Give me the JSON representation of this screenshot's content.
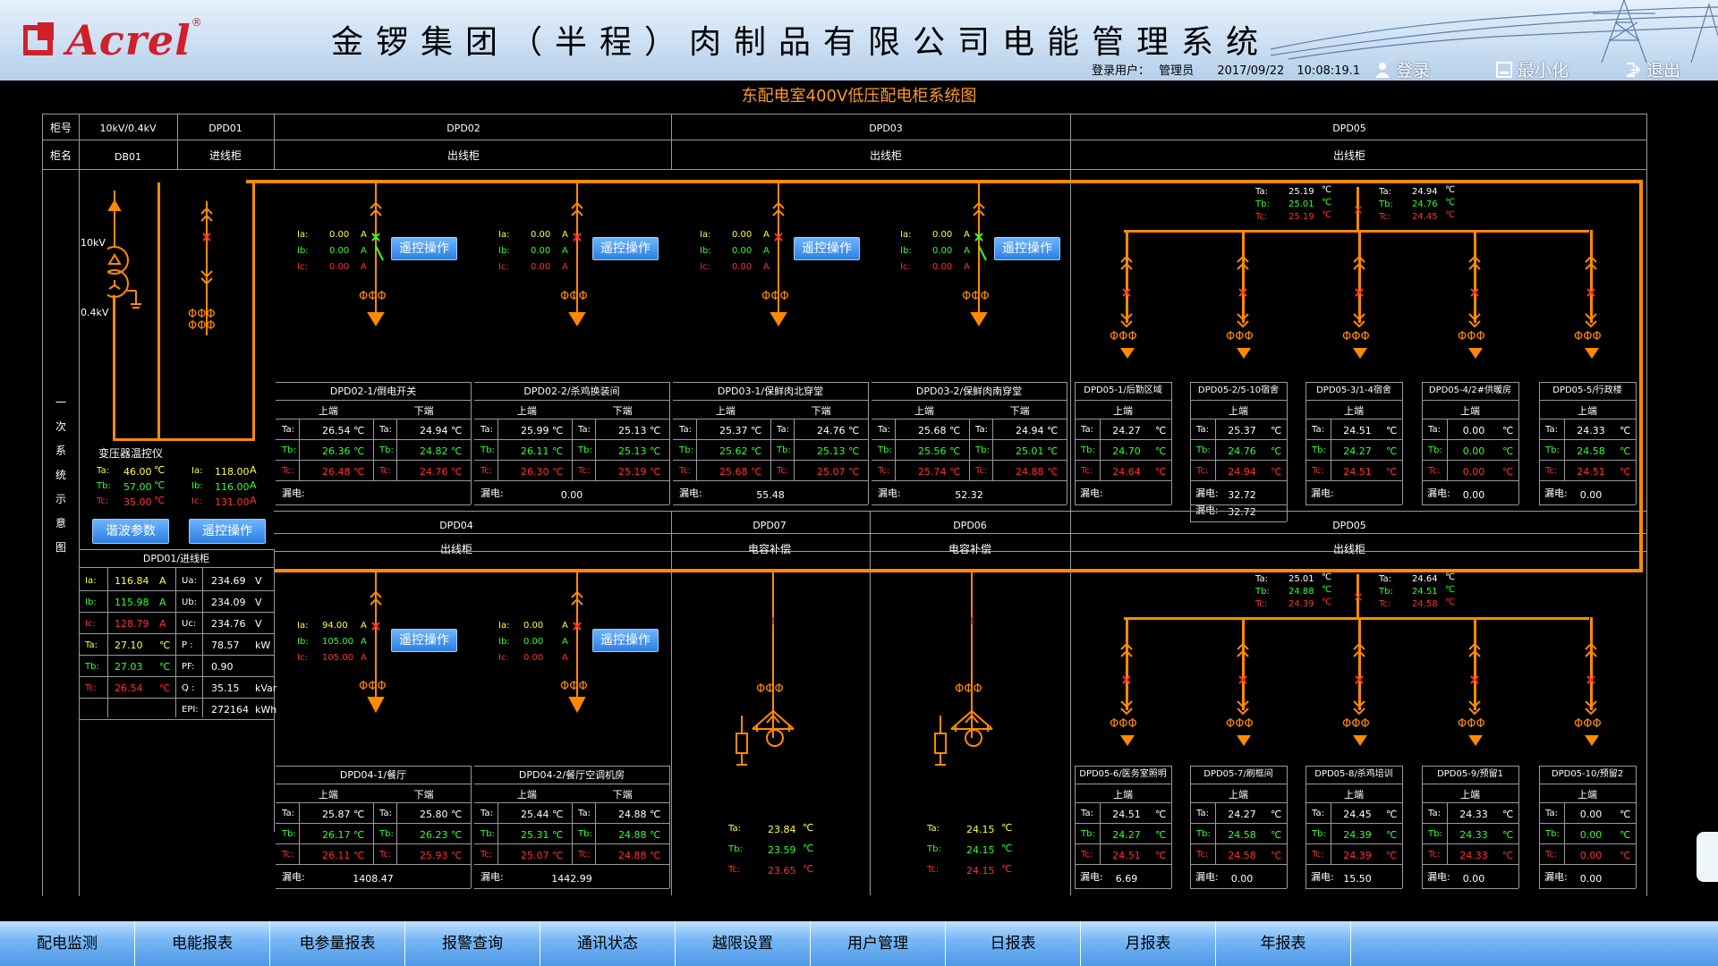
{
  "header": {
    "brand": "Acrel",
    "registered": "®",
    "title": "金锣集团（半程）肉制品有限公司电能管理系统",
    "user_label": "登录用户：",
    "user": "管理员",
    "date": "2017/09/22",
    "time": "10:08:19.1",
    "login": "登录",
    "minimize": "最小化",
    "logout": "退出"
  },
  "page_title": "东配电室400V低压配电柜系统图",
  "table": {
    "row1_label": "柜号",
    "row2_label": "柜名",
    "c1_no": "10kV/0.4kV",
    "c1_name": "DB01",
    "c2_no": "DPD01",
    "c2_name": "进线柜",
    "c3_no": "DPD02",
    "c3_name": "出线柜",
    "c4_no": "DPD03",
    "c4_name": "出线柜",
    "c5_no": "DPD05",
    "c5_name": "出线柜"
  },
  "side_label": [
    "一",
    "次",
    "系",
    "统",
    "示",
    "意",
    "图"
  ],
  "transformer": {
    "hv": "10kV",
    "lv": "0.4kV",
    "temp_title": "变压器温控仪",
    "Ta": "46.00",
    "Tb": "57.00",
    "Tc": "35.00",
    "unit": "℃",
    "harmonic_btn": "谐波参数"
  },
  "incomer": {
    "Ia": "118.00",
    "Ib": "116.00",
    "Ic": "131.00",
    "unit": "A",
    "remote_btn": "遥控操作",
    "panel_title": "DPD01/进线柜",
    "rows": [
      [
        "Ia:",
        "116.84",
        "A",
        "Ua:",
        "234.69",
        "V"
      ],
      [
        "Ib:",
        "115.98",
        "A",
        "Ub:",
        "234.09",
        "V"
      ],
      [
        "Ic:",
        "128.79",
        "A",
        "Uc:",
        "234.76",
        "V"
      ],
      [
        "Ta:",
        "27.10",
        "℃",
        "P :",
        "78.57",
        "kW"
      ],
      [
        "Tb:",
        "27.03",
        "℃",
        "PF:",
        "0.90",
        ""
      ],
      [
        "Tc:",
        "26.54",
        "℃",
        "Q :",
        "35.15",
        "kVar"
      ],
      [
        "",
        "",
        "",
        "EPI:",
        "272164",
        "kWh"
      ]
    ]
  },
  "labels": {
    "Ta": "Ta:",
    "Tb": "Tb:",
    "Tc": "Tc:",
    "Ia": "Ia:",
    "Ib": "Ib:",
    "Ic": "Ic:",
    "up": "上端",
    "down": "下端",
    "leak": "漏电:",
    "deg": "℃",
    "amp": "A",
    "remote": "遥控操作"
  },
  "top_feeders": [
    {
      "Ia": "0.00",
      "Ib": "0.00",
      "Ic": "0.00",
      "closed": true
    },
    {
      "Ia": "0.00",
      "Ib": "0.00",
      "Ic": "0.00",
      "closed": false
    },
    {
      "Ia": "0.00",
      "Ib": "0.00",
      "Ic": "0.00",
      "closed": false
    },
    {
      "Ia": "0.00",
      "Ib": "0.00",
      "Ic": "0.00",
      "closed": true
    }
  ],
  "top_panels": [
    {
      "title": "DPD02-1/倒电开关",
      "up": [
        "26.54",
        "26.36",
        "26.48"
      ],
      "down": [
        "24.94",
        "24.82",
        "24.76"
      ],
      "leak": ""
    },
    {
      "title": "DPD02-2/杀鸡换装间",
      "up": [
        "25.99",
        "26.11",
        "26.30"
      ],
      "down": [
        "25.13",
        "25.13",
        "25.19"
      ],
      "leak": "0.00"
    },
    {
      "title": "DPD03-1/保鲜肉北穿堂",
      "up": [
        "25.37",
        "25.62",
        "25.68"
      ],
      "down": [
        "24.76",
        "25.13",
        "25.07"
      ],
      "leak": "55.48"
    },
    {
      "title": "DPD03-2/保鲜肉南穿堂",
      "up": [
        "25.68",
        "25.56",
        "25.74"
      ],
      "down": [
        "24.94",
        "25.01",
        "24.88"
      ],
      "leak": "52.32"
    }
  ],
  "dpd05_top": {
    "tempA": {
      "Ta": "25.19",
      "Tb": "25.01",
      "Tc": "25.19"
    },
    "tempB": {
      "Ta": "24.94",
      "Tb": "24.76",
      "Tc": "24.45"
    },
    "panels": [
      {
        "title": "DPD05-1/后勤区域",
        "vals": [
          "24.27",
          "24.70",
          "24.64"
        ],
        "leak": ""
      },
      {
        "title": "DPD05-2/5-10宿舍",
        "vals": [
          "25.37",
          "24.76",
          "24.94"
        ],
        "leak": "32.72",
        "leak2": "32.72"
      },
      {
        "title": "DPD05-3/1-4宿舍",
        "vals": [
          "24.51",
          "24.27",
          "24.51"
        ],
        "leak": ""
      },
      {
        "title": "DPD05-4/2#供暖房",
        "vals": [
          "0.00",
          "0.00",
          "0.00"
        ],
        "leak": "0.00"
      },
      {
        "title": "DPD05-5/行政楼",
        "vals": [
          "24.33",
          "24.58",
          "24.51"
        ],
        "leak": "0.00"
      }
    ]
  },
  "mid_headers": {
    "c1_no": "DPD04",
    "c1_name": "出线柜",
    "c2_no": "DPD07",
    "c2_name": "电容补偿",
    "c3_no": "DPD06",
    "c3_name": "电容补偿",
    "c4_no": "DPD05",
    "c4_name": "出线柜"
  },
  "bottom_feeders": [
    {
      "Ia": "94.00",
      "Ib": "105.00",
      "Ic": "105.00"
    },
    {
      "Ia": "0.00",
      "Ib": "0.00",
      "Ic": "0.00"
    }
  ],
  "bottom_panels": [
    {
      "title": "DPD04-1/餐厅",
      "up": [
        "25.87",
        "26.17",
        "26.11"
      ],
      "down": [
        "25.80",
        "26.23",
        "25.93"
      ],
      "leak": "1408.47"
    },
    {
      "title": "DPD04-2/餐厅空调机房",
      "up": [
        "25.44",
        "25.31",
        "25.07"
      ],
      "down": [
        "24.88",
        "24.88",
        "24.88"
      ],
      "leak": "1442.99"
    }
  ],
  "caps": [
    {
      "Ta": "23.84",
      "Tb": "23.59",
      "Tc": "23.65"
    },
    {
      "Ta": "24.15",
      "Tb": "24.15",
      "Tc": "24.15"
    }
  ],
  "dpd05_bot": {
    "tempA": {
      "Ta": "25.01",
      "Tb": "24.88",
      "Tc": "24.39"
    },
    "tempB": {
      "Ta": "24.64",
      "Tb": "24.51",
      "Tc": "24.58"
    },
    "panels": [
      {
        "title": "DPD05-6/医务室照明",
        "vals": [
          "24.51",
          "24.27",
          "24.51"
        ],
        "leak": "6.69"
      },
      {
        "title": "DPD05-7/刷框间",
        "vals": [
          "24.27",
          "24.58",
          "24.58"
        ],
        "leak": "0.00"
      },
      {
        "title": "DPD05-8/杀鸡培训",
        "vals": [
          "24.45",
          "24.39",
          "24.39"
        ],
        "leak": "15.50"
      },
      {
        "title": "DPD05-9/预留1",
        "vals": [
          "24.33",
          "24.33",
          "24.33"
        ],
        "leak": "0.00"
      },
      {
        "title": "DPD05-10/预留2",
        "vals": [
          "0.00",
          "0.00",
          "0.00"
        ],
        "leak": "0.00"
      }
    ]
  },
  "nav": [
    "配电监测",
    "电能报表",
    "电参量报表",
    "报警查询",
    "通讯状态",
    "越限设置",
    "用户管理",
    "日报表",
    "月报表",
    "年报表"
  ],
  "colors": {
    "bus": "#ff8a00",
    "grid": "#9a9a9a",
    "red": "#ff3030",
    "green": "#30ff30",
    "button": "#2d7fe0"
  }
}
